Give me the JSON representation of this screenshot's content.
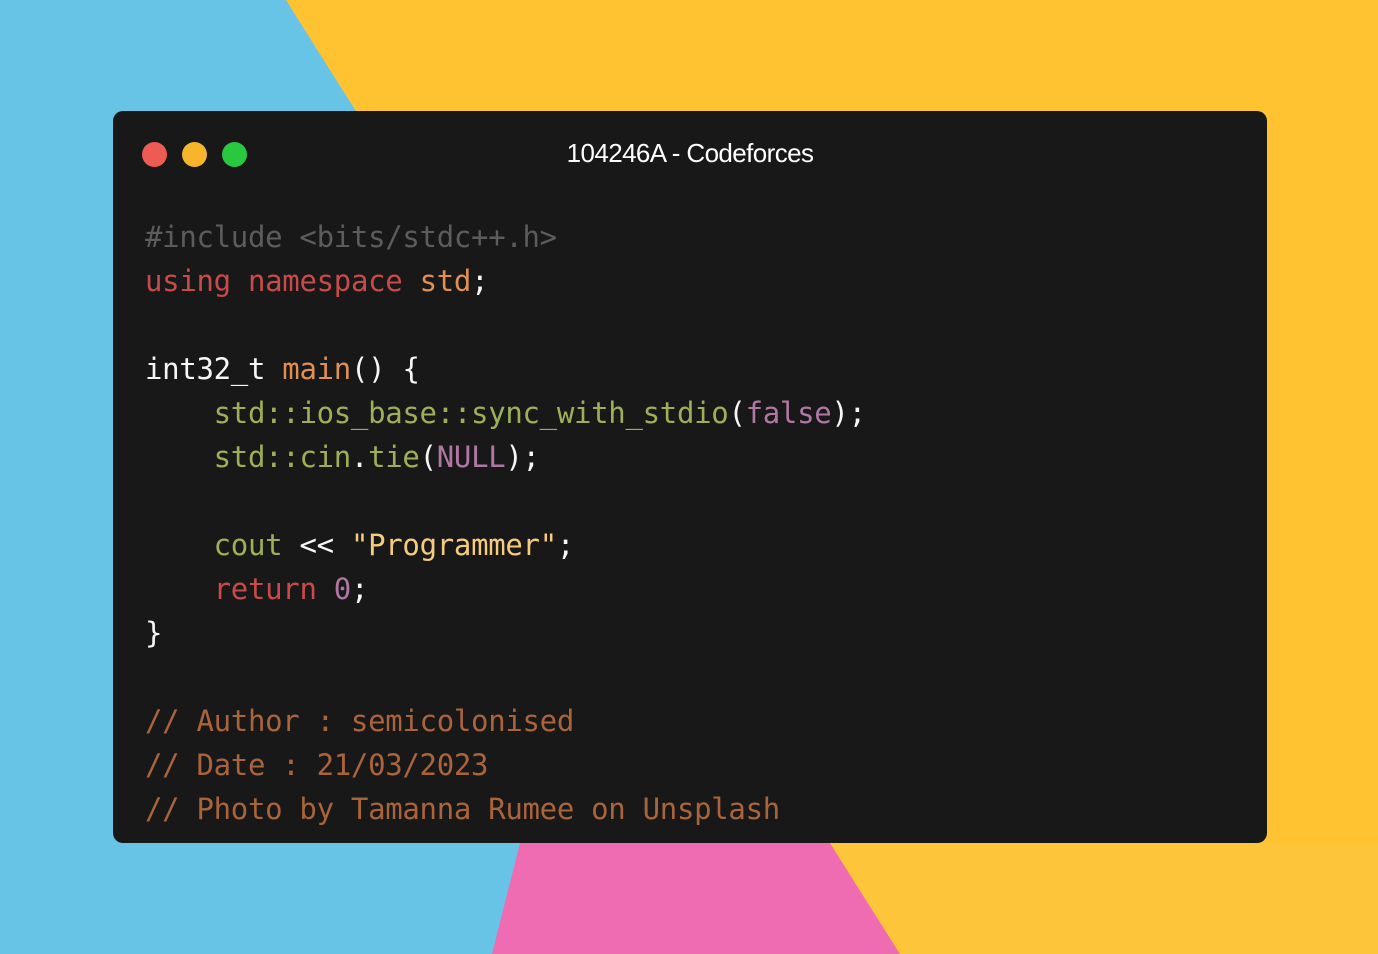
{
  "window": {
    "title": "104246A - Codeforces",
    "controls": [
      {
        "name": "close",
        "color": "#ed5b55"
      },
      {
        "name": "minimize",
        "color": "#f7b52b"
      },
      {
        "name": "maximize",
        "color": "#28c840"
      }
    ]
  },
  "colors": {
    "background_yellow": "#ffc832",
    "background_blue": "#64c3e6",
    "background_pink": "#ee6ab2",
    "window_background": "#181818",
    "preprocessor": "#5c5c5c",
    "keyword": "#c94a4a",
    "function": "#e09050",
    "plain": "#f6f6f6",
    "identifier_green": "#9db057",
    "literal_purple": "#b177a3",
    "string": "#f5cc7e",
    "comment": "#a9643c"
  },
  "code": {
    "include": "#include <bits/stdc++.h>",
    "using_kw": "using",
    "namespace_kw": "namespace",
    "std_name": "std",
    "semicolon": ";",
    "main_type": "int32_t",
    "main_name": "main",
    "main_parens": "()",
    "open_brace": "{",
    "sync_call": "std::ios_base::sync_with_stdio",
    "paren_open": "(",
    "false_lit": "false",
    "paren_close_semi": ");",
    "cin_ns": "std::cin",
    "dot": ".",
    "tie_fn": "tie",
    "null_lit": "NULL",
    "cout_name": "cout",
    "shift_op": "<<",
    "string_lit": "\"Programmer\"",
    "return_kw": "return",
    "zero_lit": "0",
    "close_brace": "}",
    "comment_author": "// Author : semicolonised",
    "comment_date": "// Date : 21/03/2023",
    "comment_photo": "// Photo by Tamanna Rumee on Unsplash"
  }
}
